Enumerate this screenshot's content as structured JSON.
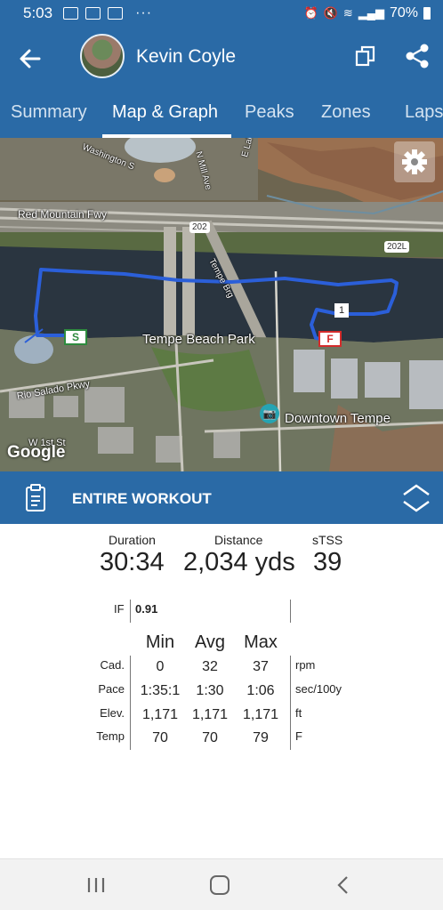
{
  "status_bar": {
    "time": "5:03",
    "battery": "70%",
    "more": "···"
  },
  "header": {
    "athlete_name": "Kevin Coyle"
  },
  "tabs": [
    {
      "label": "Summary",
      "active": false
    },
    {
      "label": "Map & Graph",
      "active": true
    },
    {
      "label": "Peaks",
      "active": false
    },
    {
      "label": "Zones",
      "active": false
    },
    {
      "label": "Laps",
      "active": false
    }
  ],
  "map": {
    "labels": {
      "washington_st": "Washington S",
      "mill_ave": "N Mill Ave",
      "lake_view_dr": "E Lake View Dr",
      "red_mountain_fwy": "Red Mountain Fwy",
      "route_202": "202",
      "route_202l": "202L",
      "tempe_brg": "Tempe Brg",
      "tempe_beach_park": "Tempe Beach Park",
      "rio_salado_pkwy": "Rio Salado Pkwy",
      "downtown_tempe": "Downtown Tempe",
      "w_1st_st": "W 1st St"
    },
    "markers": {
      "start": "S",
      "finish": "F",
      "lap": "1"
    },
    "attribution": "Google",
    "route_color": "#2b5fd9"
  },
  "section": {
    "title": "ENTIRE WORKOUT"
  },
  "summary": {
    "duration": {
      "label": "Duration",
      "value": "30:34"
    },
    "distance": {
      "label": "Distance",
      "value": "2,034 yds"
    },
    "stss": {
      "label": "sTSS",
      "value": "39"
    }
  },
  "intensity": {
    "label": "IF",
    "value": "0.91"
  },
  "metrics": {
    "columns": [
      "Min",
      "Avg",
      "Max"
    ],
    "rows": [
      {
        "label": "Cad.",
        "min": "0",
        "avg": "32",
        "max": "37",
        "unit": "rpm"
      },
      {
        "label": "Pace",
        "min": "1:35:1",
        "avg": "1:30",
        "max": "1:06",
        "unit": "sec/100y"
      },
      {
        "label": "Elev.",
        "min": "1,171",
        "avg": "1,171",
        "max": "1,171",
        "unit": "ft"
      },
      {
        "label": "Temp",
        "min": "70",
        "avg": "70",
        "max": "79",
        "unit": "F"
      }
    ]
  },
  "colors": {
    "primary": "#2a6aa6",
    "lake": "#2a3540"
  }
}
